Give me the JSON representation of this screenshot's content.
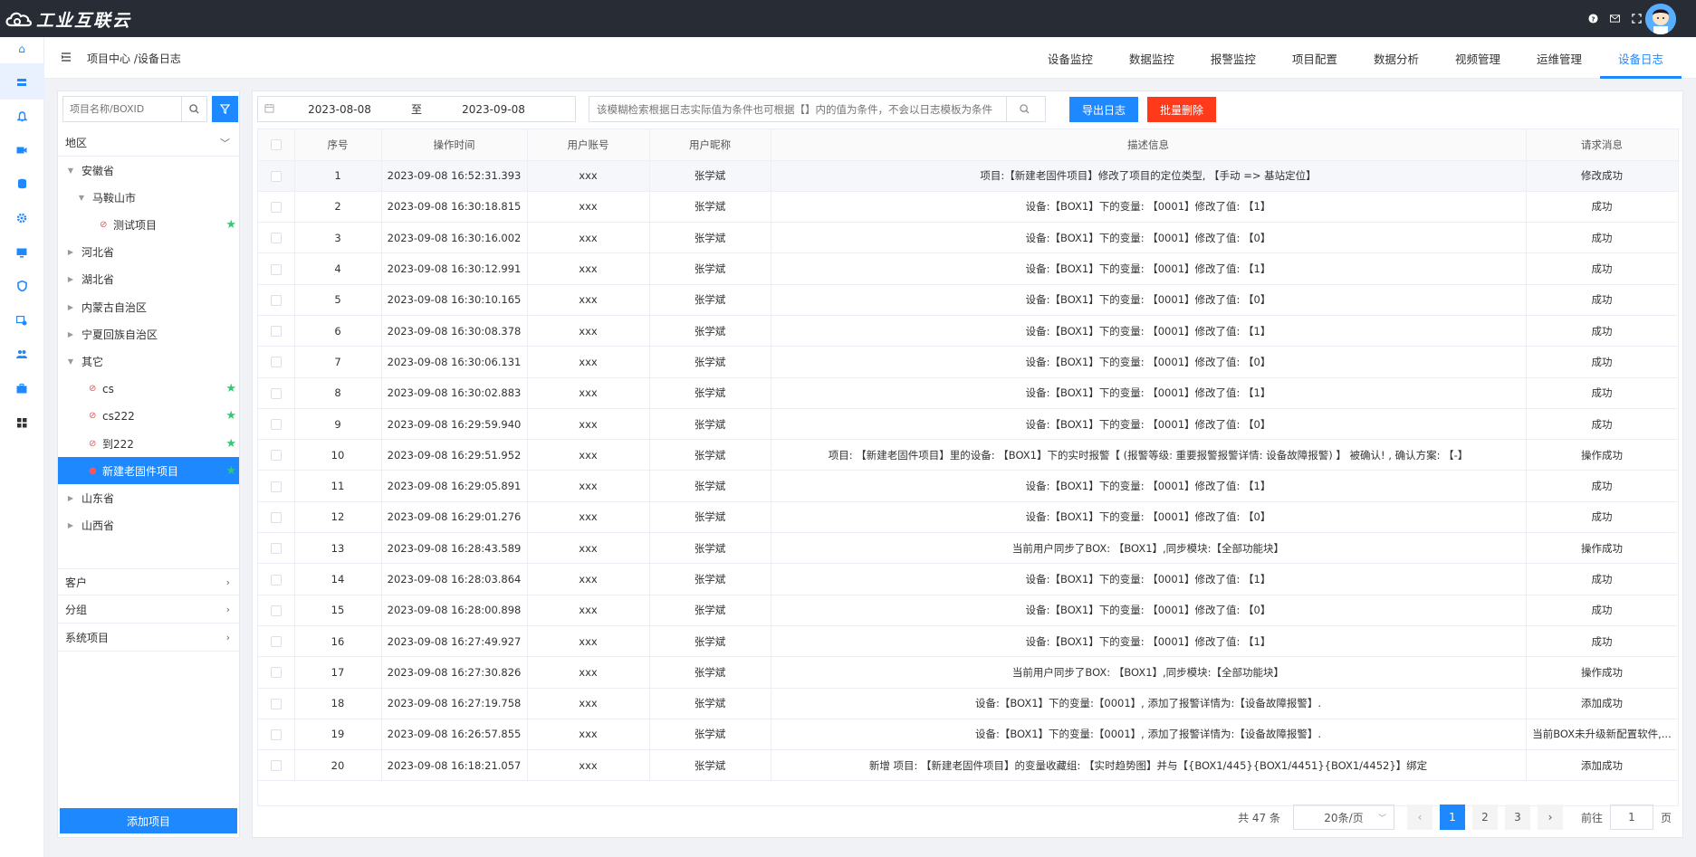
{
  "app": {
    "logo_text": "工业互联云"
  },
  "header": {
    "breadcrumb": "项目中心 /设备日志",
    "tabs": [
      {
        "label": "设备监控"
      },
      {
        "label": "数据监控"
      },
      {
        "label": "报警监控"
      },
      {
        "label": "项目配置"
      },
      {
        "label": "数据分析"
      },
      {
        "label": "视频管理"
      },
      {
        "label": "运维管理"
      },
      {
        "label": "设备日志"
      }
    ],
    "active_tab": "设备日志"
  },
  "rail_icons": [
    "home-icon",
    "layers-icon",
    "bell-icon",
    "video-icon",
    "database-icon",
    "settings-icon",
    "monitor-icon",
    "shield-icon",
    "chart-icon",
    "users-icon",
    "briefcase-icon",
    "grid-icon"
  ],
  "left_panel": {
    "search_placeholder": "项目名称/BOXID",
    "sections": {
      "region": "地区",
      "customer": "客户",
      "group": "分组",
      "system": "系统项目"
    },
    "tree": [
      {
        "label": "安徽省",
        "level": 0,
        "expanded": true
      },
      {
        "label": "马鞍山市",
        "level": 1,
        "expanded": true
      },
      {
        "label": "测试项目",
        "level": 2,
        "leaf": true,
        "star": true
      },
      {
        "label": "河北省",
        "level": 0
      },
      {
        "label": "湖北省",
        "level": 0
      },
      {
        "label": "内蒙古自治区",
        "level": 0
      },
      {
        "label": "宁夏回族自治区",
        "level": 0
      },
      {
        "label": "其它",
        "level": 0,
        "expanded": true
      },
      {
        "label": "cs",
        "level": 1,
        "leaf": true,
        "star": true
      },
      {
        "label": "cs222",
        "level": 1,
        "leaf": true,
        "star": true
      },
      {
        "label": "到222",
        "level": 1,
        "leaf": true,
        "star": true
      },
      {
        "label": "新建老固件项目",
        "level": 1,
        "leaf": true,
        "star": true,
        "selected": true
      },
      {
        "label": "山东省",
        "level": 0
      },
      {
        "label": "山西省",
        "level": 0
      }
    ],
    "add_button": "添加项目"
  },
  "filters": {
    "date_start": "2023-08-08",
    "date_sep": "至",
    "date_end": "2023-09-08",
    "search_placeholder": "该模糊检索根据日志实际值为条件也可根据【】内的值为条件，不会以日志模板为条件",
    "export_label": "导出日志",
    "delete_label": "批量删除"
  },
  "table": {
    "columns": [
      "序号",
      "操作时间",
      "用户账号",
      "用户昵称",
      "描述信息",
      "请求消息"
    ],
    "rows": [
      [
        "1",
        "2023-09-08 16:52:31.393",
        "xxx",
        "张学斌",
        "项目:【新建老固件项目】修改了项目的定位类型, 【手动 => 基站定位】",
        "修改成功"
      ],
      [
        "2",
        "2023-09-08 16:30:18.815",
        "xxx",
        "张学斌",
        "设备:【BOX1】下的变量: 【0001】修改了值: 【1】",
        "成功"
      ],
      [
        "3",
        "2023-09-08 16:30:16.002",
        "xxx",
        "张学斌",
        "设备:【BOX1】下的变量: 【0001】修改了值: 【0】",
        "成功"
      ],
      [
        "4",
        "2023-09-08 16:30:12.991",
        "xxx",
        "张学斌",
        "设备:【BOX1】下的变量: 【0001】修改了值: 【1】",
        "成功"
      ],
      [
        "5",
        "2023-09-08 16:30:10.165",
        "xxx",
        "张学斌",
        "设备:【BOX1】下的变量: 【0001】修改了值: 【0】",
        "成功"
      ],
      [
        "6",
        "2023-09-08 16:30:08.378",
        "xxx",
        "张学斌",
        "设备:【BOX1】下的变量: 【0001】修改了值: 【1】",
        "成功"
      ],
      [
        "7",
        "2023-09-08 16:30:06.131",
        "xxx",
        "张学斌",
        "设备:【BOX1】下的变量: 【0001】修改了值: 【0】",
        "成功"
      ],
      [
        "8",
        "2023-09-08 16:30:02.883",
        "xxx",
        "张学斌",
        "设备:【BOX1】下的变量: 【0001】修改了值: 【1】",
        "成功"
      ],
      [
        "9",
        "2023-09-08 16:29:59.940",
        "xxx",
        "张学斌",
        "设备:【BOX1】下的变量: 【0001】修改了值: 【0】",
        "成功"
      ],
      [
        "10",
        "2023-09-08 16:29:51.952",
        "xxx",
        "张学斌",
        "项目: 【新建老固件项目】里的设备: 【BOX1】下的实时报警【 (报警等级: 重要报警报警详情: 设备故障报警) 】 被确认! , 确认方案: 【-】",
        "操作成功"
      ],
      [
        "11",
        "2023-09-08 16:29:05.891",
        "xxx",
        "张学斌",
        "设备:【BOX1】下的变量: 【0001】修改了值: 【1】",
        "成功"
      ],
      [
        "12",
        "2023-09-08 16:29:01.276",
        "xxx",
        "张学斌",
        "设备:【BOX1】下的变量: 【0001】修改了值: 【0】",
        "成功"
      ],
      [
        "13",
        "2023-09-08 16:28:43.589",
        "xxx",
        "张学斌",
        "当前用户同步了BOX: 【BOX1】,同步模块:【全部功能块】",
        "操作成功"
      ],
      [
        "14",
        "2023-09-08 16:28:03.864",
        "xxx",
        "张学斌",
        "设备:【BOX1】下的变量: 【0001】修改了值: 【1】",
        "成功"
      ],
      [
        "15",
        "2023-09-08 16:28:00.898",
        "xxx",
        "张学斌",
        "设备:【BOX1】下的变量: 【0001】修改了值: 【0】",
        "成功"
      ],
      [
        "16",
        "2023-09-08 16:27:49.927",
        "xxx",
        "张学斌",
        "设备:【BOX1】下的变量: 【0001】修改了值: 【1】",
        "成功"
      ],
      [
        "17",
        "2023-09-08 16:27:30.826",
        "xxx",
        "张学斌",
        "当前用户同步了BOX: 【BOX1】,同步模块:【全部功能块】",
        "操作成功"
      ],
      [
        "18",
        "2023-09-08 16:27:19.758",
        "xxx",
        "张学斌",
        "设备:【BOX1】下的变量:【0001】, 添加了报警详情为:【设备故障报警】.",
        "添加成功"
      ],
      [
        "19",
        "2023-09-08 16:26:57.855",
        "xxx",
        "张学斌",
        "设备:【BOX1】下的变量:【0001】, 添加了报警详情为:【设备故障报警】.",
        "当前BOX未升级新配置软件,..."
      ],
      [
        "20",
        "2023-09-08 16:18:21.057",
        "xxx",
        "张学斌",
        "新增 项目: 【新建老固件项目】的变量收藏组: 【实时趋势图】并与【{BOX1/445}{BOX1/4451}{BOX1/4452}】绑定",
        "添加成功"
      ]
    ]
  },
  "pagination": {
    "total": "共 47 条",
    "page_size": "20条/页",
    "pages": [
      "1",
      "2",
      "3"
    ],
    "current_page": "1",
    "goto_label": "前往",
    "goto_value": "1",
    "page_suffix": "页"
  }
}
